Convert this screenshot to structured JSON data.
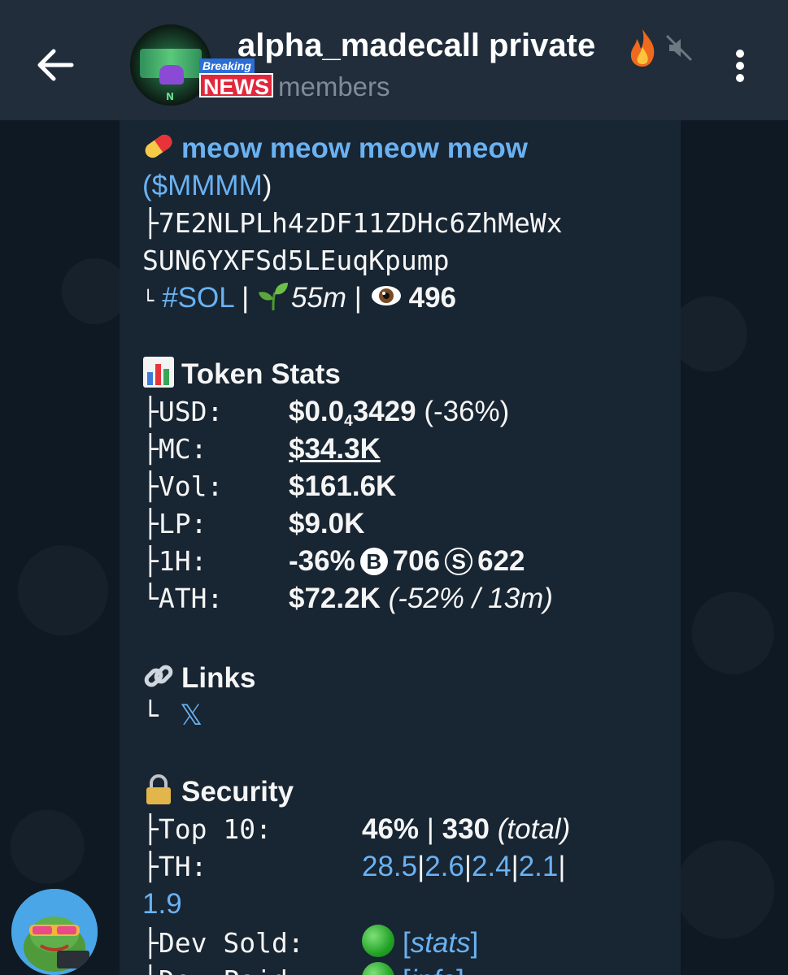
{
  "header": {
    "back_label": "Back",
    "chat_title": "alpha_madecall private",
    "title_emoji": "fire-emoji",
    "subtitle": "members",
    "avatar_badge_top": "Breaking",
    "avatar_badge_bottom": "NEWS",
    "avatar_letter": "N"
  },
  "message": {
    "token_name": "meow meow meow meow",
    "ticker_open": "(",
    "ticker": "$MMMM",
    "ticker_close": ")",
    "branch_mid": "├",
    "branch_end": "└",
    "address_line1": "7E2NLPLh4zDF11ZDHc6ZhMeWx",
    "address_line2": "SUN6YXFSd5LEuqKpump",
    "chain_tag": "#SOL",
    "sep": "|",
    "age": "55m",
    "views": "496",
    "stats_title": "Token Stats",
    "stats": {
      "usd_label": "USD:",
      "usd_value_prefix": "$0.0",
      "usd_value_sub": "4",
      "usd_value_main": "3429",
      "usd_change": "(-36%)",
      "mc_label": "MC:",
      "mc_value": "$34.3K",
      "vol_label": "Vol:",
      "vol_value": "$161.6K",
      "lp_label": "LP:",
      "lp_value": "$9.0K",
      "h1_label": "1H:",
      "h1_change": "-36%",
      "h1_buys_icon": "B",
      "h1_buys": "706",
      "h1_sells_icon": "S",
      "h1_sells": "622",
      "ath_label": "ATH:",
      "ath_value": "$72.2K",
      "ath_detail": "(-52% / 13m)"
    },
    "links_title": "Links",
    "x_link": "𝕏",
    "security_title": "Security",
    "security": {
      "top10_label": "Top 10:",
      "top10_value": "46%",
      "top10_sep": "|",
      "top10_total": "330",
      "top10_total_label": "(total)",
      "th_label": "TH:",
      "th_values": [
        "28.5",
        "2.6",
        "2.4",
        "2.1",
        "1.9"
      ],
      "dev_sold_label": "Dev Sold:",
      "dev_sold_link": "stats",
      "dev_paid_label": "Dev Paid:",
      "dev_paid_link": "info"
    }
  },
  "colors": {
    "header_bg": "#212d3b",
    "bubble_bg": "#182533",
    "link": "#6ab2f2",
    "text": "#f5f5f5",
    "muted": "#7f8b98"
  }
}
